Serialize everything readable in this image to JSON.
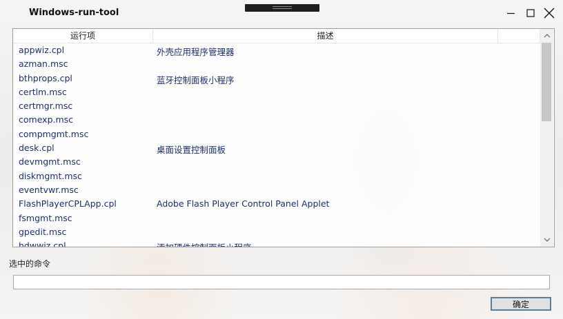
{
  "window": {
    "title": "Windows-run-tool"
  },
  "list": {
    "columns": [
      "运行项",
      "描述"
    ],
    "rows": [
      {
        "name": "appwiz.cpl",
        "desc": "外壳应用程序管理器"
      },
      {
        "name": "azman.msc",
        "desc": ""
      },
      {
        "name": "bthprops.cpl",
        "desc": "蓝牙控制面板小程序"
      },
      {
        "name": "certlm.msc",
        "desc": ""
      },
      {
        "name": "certmgr.msc",
        "desc": ""
      },
      {
        "name": "comexp.msc",
        "desc": ""
      },
      {
        "name": "compmgmt.msc",
        "desc": ""
      },
      {
        "name": "desk.cpl",
        "desc": "桌面设置控制面板"
      },
      {
        "name": "devmgmt.msc",
        "desc": ""
      },
      {
        "name": "diskmgmt.msc",
        "desc": ""
      },
      {
        "name": "eventvwr.msc",
        "desc": ""
      },
      {
        "name": "FlashPlayerCPLApp.cpl",
        "desc": "Adobe Flash Player Control Panel Applet"
      },
      {
        "name": "fsmgmt.msc",
        "desc": ""
      },
      {
        "name": "gpedit.msc",
        "desc": ""
      },
      {
        "name": "hdwwiz.cpl",
        "desc": "添加硬件控制面板小程序"
      }
    ]
  },
  "command": {
    "label": "选中的命令",
    "value": ""
  },
  "buttons": {
    "ok_label": "确定"
  },
  "icons": {
    "minimize": "minimize-icon",
    "maximize": "maximize-icon",
    "close": "close-icon",
    "scroll_up": "chevron-up-icon",
    "scroll_down": "chevron-down-icon"
  }
}
